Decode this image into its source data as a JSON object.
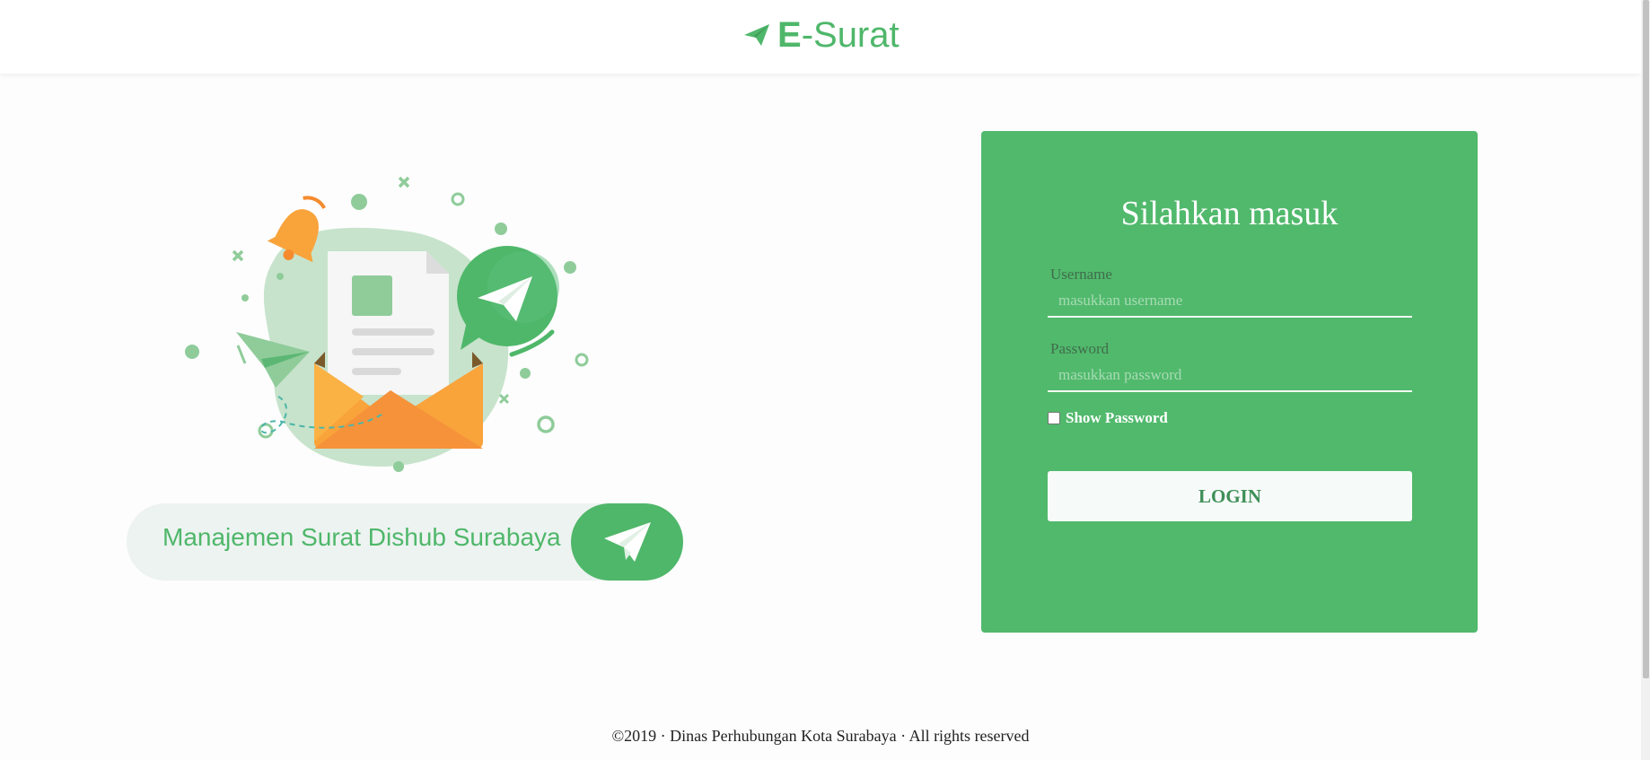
{
  "header": {
    "brand_bold": "E",
    "brand_rest": "-Surat",
    "logo_icon": "paper-plane-icon"
  },
  "hero": {
    "tagline": "Manajemen Surat Dishub Surabaya",
    "tagline_icon": "paper-plane-icon"
  },
  "login": {
    "title": "Silahkan masuk",
    "username_label": "Username",
    "username_placeholder": "masukkan username",
    "username_value": "",
    "password_label": "Password",
    "password_placeholder": "masukkan password",
    "password_value": "",
    "show_password_label": "Show Password",
    "show_password_checked": false,
    "submit_label": "LOGIN"
  },
  "footer": {
    "text": "©2019 · Dinas Perhubungan Kota Surabaya · All rights reserved"
  },
  "colors": {
    "brand_green": "#4fb76a",
    "card_green": "#51b96c",
    "envelope_orange": "#f9a33b"
  }
}
